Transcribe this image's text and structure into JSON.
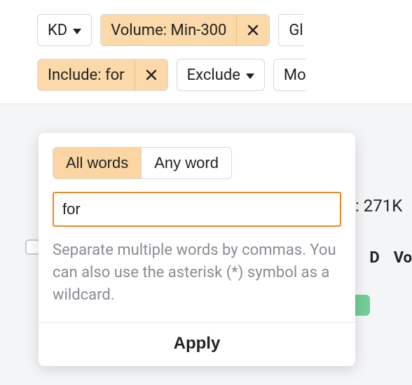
{
  "filters": {
    "kd_label": "KD",
    "volume_label": "Volume: Min-300",
    "global_label": "Gl",
    "include_label": "Include: for",
    "exclude_label": "Exclude",
    "more_label": "Mo"
  },
  "popover": {
    "tabs": {
      "all_words": "All words",
      "any_word": "Any word"
    },
    "input_value": "for",
    "help": "Separate multiple words by commas. You can also use the asterisk (*) symbol as a wildcard.",
    "apply": "Apply"
  },
  "results": {
    "total_suffix": ": 271K",
    "columns": {
      "kd": "D",
      "volume": "Vo"
    }
  }
}
